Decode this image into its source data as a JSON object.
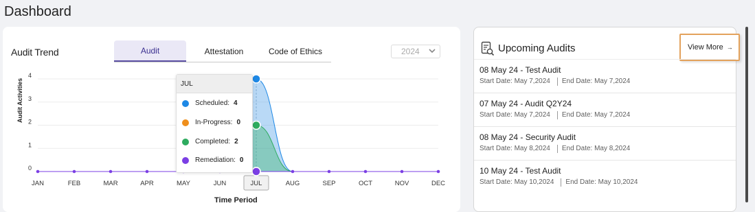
{
  "page": {
    "title": "Dashboard"
  },
  "audit_trend": {
    "title": "Audit Trend",
    "tabs": [
      {
        "label": "Audit",
        "active": true
      },
      {
        "label": "Attestation",
        "active": false
      },
      {
        "label": "Code of Ethics",
        "active": false
      }
    ],
    "year": "2024",
    "tooltip": {
      "month": "JUL",
      "rows": [
        {
          "label": "Scheduled:",
          "value": "4",
          "color": "#1e88e5"
        },
        {
          "label": "In-Progress:",
          "value": "0",
          "color": "#ef8f1c"
        },
        {
          "label": "Completed:",
          "value": "2",
          "color": "#2eab5f"
        },
        {
          "label": "Remediation:",
          "value": "0",
          "color": "#7b3fe4"
        }
      ]
    }
  },
  "chart_data": {
    "type": "area",
    "categories": [
      "JAN",
      "FEB",
      "MAR",
      "APR",
      "MAY",
      "JUN",
      "JUL",
      "AUG",
      "SEP",
      "OCT",
      "NOV",
      "DEC"
    ],
    "series": [
      {
        "name": "Scheduled",
        "color": "#1e88e5",
        "values": [
          0,
          0,
          0,
          0,
          0,
          0,
          4,
          0,
          0,
          0,
          0,
          0
        ]
      },
      {
        "name": "In-Progress",
        "color": "#ef8f1c",
        "values": [
          0,
          0,
          0,
          0,
          0,
          0,
          0,
          0,
          0,
          0,
          0,
          0
        ]
      },
      {
        "name": "Completed",
        "color": "#2eab5f",
        "values": [
          0,
          0,
          0,
          0,
          0,
          0,
          2,
          0,
          0,
          0,
          0,
          0
        ]
      },
      {
        "name": "Remediation",
        "color": "#7b3fe4",
        "values": [
          0,
          0,
          0,
          0,
          0,
          0,
          0,
          0,
          0,
          0,
          0,
          0
        ]
      }
    ],
    "ylim": [
      0,
      4
    ],
    "yticks": [
      "0",
      "1",
      "2",
      "3",
      "4"
    ],
    "xlabel": "Time Period",
    "ylabel": "Audit Activities",
    "highlight": "JUL"
  },
  "upcoming": {
    "title": "Upcoming Audits",
    "view_more": "View More",
    "items": [
      {
        "name": "08 May 24 - Test Audit",
        "start": "Start Date: May 7,2024",
        "end": "End Date: May 7,2024"
      },
      {
        "name": "07 May 24 - Audit Q2Y24",
        "start": "Start Date: May 7,2024",
        "end": "End Date: May 7,2024"
      },
      {
        "name": "08 May 24 - Security Audit",
        "start": "Start Date: May 8,2024",
        "end": "End Date: May 8,2024"
      },
      {
        "name": "10 May 24 - Test Audit",
        "start": "Start Date: May 10,2024",
        "end": "End Date: May 10,2024"
      }
    ]
  }
}
